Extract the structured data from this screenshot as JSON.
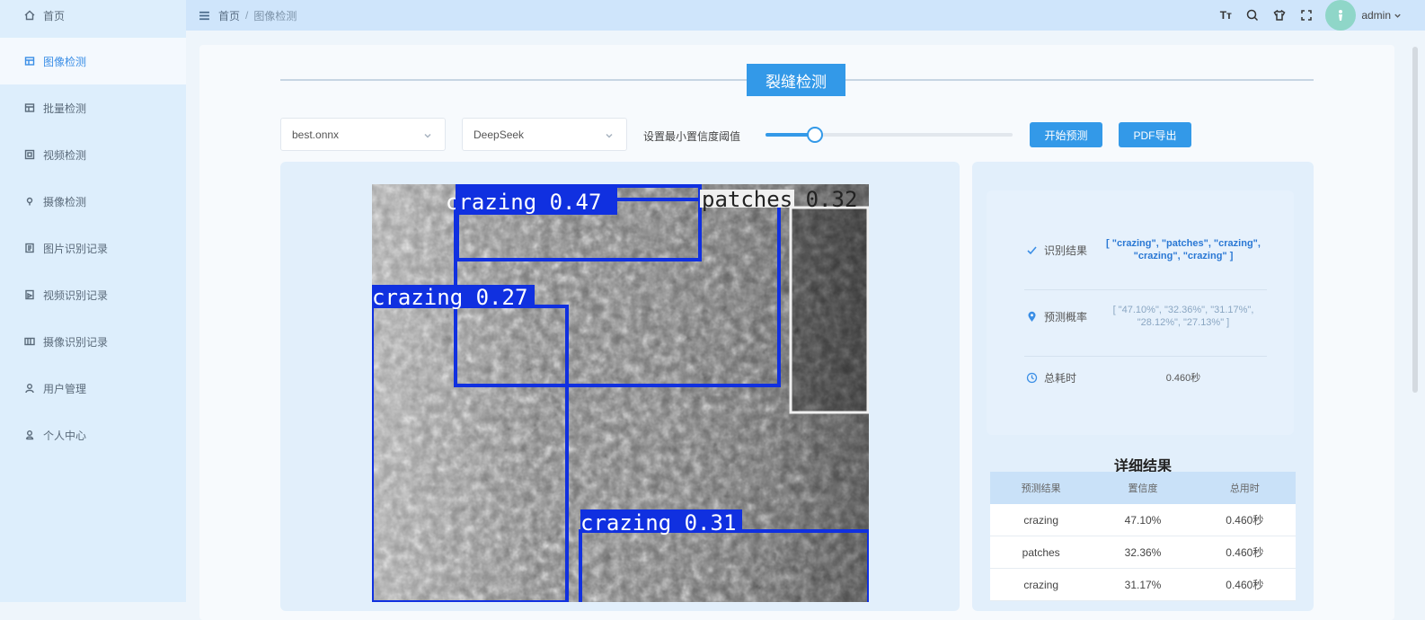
{
  "sidebar": {
    "items": [
      {
        "label": "首页",
        "icon": "home-icon"
      },
      {
        "label": "图像检测",
        "icon": "image-icon",
        "active": true
      },
      {
        "label": "批量检测",
        "icon": "batch-icon"
      },
      {
        "label": "视频检测",
        "icon": "video-icon"
      },
      {
        "label": "摄像检测",
        "icon": "camera-icon"
      },
      {
        "label": "图片识别记录",
        "icon": "document-icon"
      },
      {
        "label": "视频识别记录",
        "icon": "video-record-icon"
      },
      {
        "label": "摄像识别记录",
        "icon": "camera-record-icon"
      },
      {
        "label": "用户管理",
        "icon": "user-icon"
      },
      {
        "label": "个人中心",
        "icon": "profile-icon"
      }
    ]
  },
  "header": {
    "breadcrumb": [
      "首页",
      "图像检测"
    ],
    "font_size_label": "Tт",
    "user": "admin"
  },
  "page": {
    "title": "裂缝检测",
    "model_select": "best.onnx",
    "llm_select": "DeepSeek",
    "threshold_label": "设置最小置信度阈值",
    "threshold_value": 0.2,
    "start_button": "开始预测",
    "pdf_button": "PDF导出"
  },
  "detections": [
    {
      "label": "crazing 0.47"
    },
    {
      "label": "patches 0.32"
    },
    {
      "label": "crazing 0.27"
    },
    {
      "label": "crazing 0.31"
    }
  ],
  "summary": {
    "result_label": "识别结果",
    "result_value": "[ \"crazing\", \"patches\", \"crazing\", \"crazing\", \"crazing\" ]",
    "prob_label": "预测概率",
    "prob_value": "[ \"47.10%\", \"32.36%\", \"31.17%\", \"28.12%\", \"27.13%\" ]",
    "time_label": "总耗时",
    "time_value": "0.460秒"
  },
  "detail": {
    "title": "详细结果",
    "columns": [
      "预测结果",
      "置信度",
      "总用时"
    ],
    "rows": [
      [
        "crazing",
        "47.10%",
        "0.460秒"
      ],
      [
        "patches",
        "32.36%",
        "0.460秒"
      ],
      [
        "crazing",
        "31.17%",
        "0.460秒"
      ]
    ]
  },
  "colors": {
    "accent": "#3399e8",
    "box_blue": "#1030e0",
    "box_white": "#ffffff"
  }
}
